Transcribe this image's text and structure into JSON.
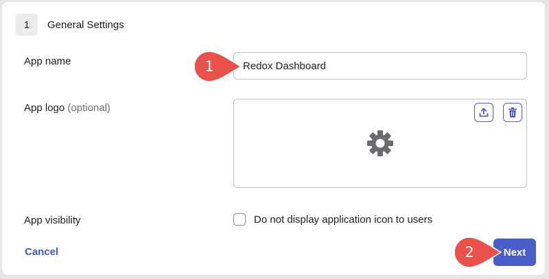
{
  "step": {
    "number": "1",
    "title": "General Settings"
  },
  "fields": {
    "app_name_label": "App name",
    "app_name_value": "Redox Dashboard",
    "app_logo_label": "App logo",
    "app_logo_optional": "(optional)",
    "app_visibility_label": "App visibility",
    "visibility_checkbox_label": "Do not display application icon to users",
    "visibility_checked": false
  },
  "actions": {
    "cancel_label": "Cancel",
    "next_label": "Next"
  },
  "icons": {
    "upload": "upload-icon",
    "delete": "trash-icon",
    "logo_placeholder": "gear-icon"
  },
  "annotations": {
    "callout_1": "1",
    "callout_2": "2"
  },
  "colors": {
    "accent": "#4a5ec9",
    "callout": "#e8524a"
  }
}
